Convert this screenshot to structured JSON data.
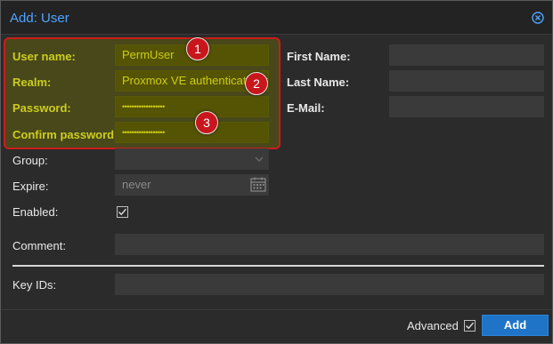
{
  "dialog": {
    "title": "Add: User",
    "close_icon": "close-circle-icon"
  },
  "form": {
    "username": {
      "label": "User name:",
      "value": "PermUser"
    },
    "realm": {
      "label": "Realm:",
      "value": "Proxmox VE authentication server"
    },
    "password": {
      "label": "Password:",
      "value": "••••••••••••••••••"
    },
    "confirm_password": {
      "label": "Confirm password:",
      "value": "••••••••••••••••••"
    },
    "group": {
      "label": "Group:",
      "value": ""
    },
    "expire": {
      "label": "Expire:",
      "placeholder": "never"
    },
    "enabled": {
      "label": "Enabled:",
      "checked": true
    },
    "first_name": {
      "label": "First Name:",
      "value": ""
    },
    "last_name": {
      "label": "Last Name:",
      "value": ""
    },
    "email": {
      "label": "E-Mail:",
      "value": ""
    },
    "comment": {
      "label": "Comment:",
      "value": ""
    },
    "key_ids": {
      "label": "Key IDs:",
      "value": ""
    }
  },
  "annotations": {
    "badge_1": "1",
    "badge_2": "2",
    "badge_3": "3",
    "highlight_color": "#cc1c1c"
  },
  "footer": {
    "advanced_label": "Advanced",
    "advanced_checked": true,
    "add_label": "Add"
  },
  "colors": {
    "accent": "#4fa3ff",
    "primary_button": "#1f74c7",
    "highlight_text": "#ffff33"
  }
}
